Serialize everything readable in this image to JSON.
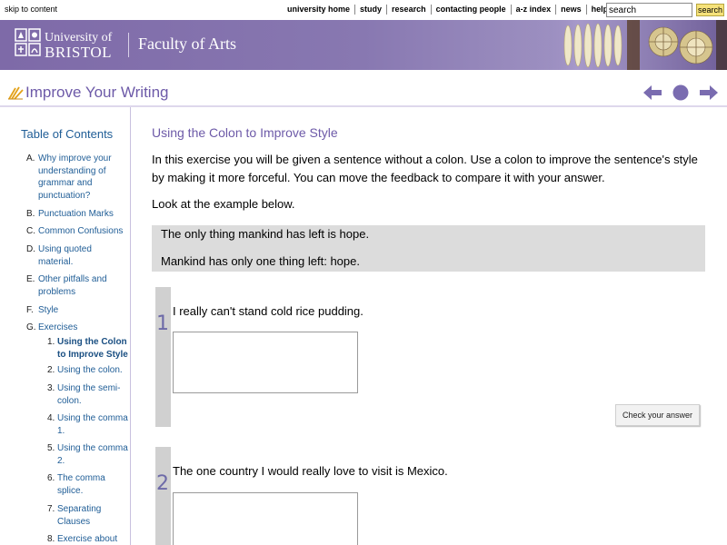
{
  "topbar": {
    "skip_link": "skip to content",
    "nav": [
      "university home",
      "study",
      "research",
      "contacting people",
      "a-z index",
      "news",
      "help"
    ],
    "search_value": "search",
    "search_button": "search"
  },
  "banner": {
    "university_line1": "University of",
    "university_line2": "BRISTOL",
    "faculty": "Faculty of Arts"
  },
  "page": {
    "title": "Improve Your Writing"
  },
  "sidebar": {
    "title": "Table of Contents",
    "items": [
      {
        "marker": "A.",
        "label": "Why improve your understanding of grammar and punctuation?"
      },
      {
        "marker": "B.",
        "label": "Punctuation Marks"
      },
      {
        "marker": "C.",
        "label": "Common Confusions"
      },
      {
        "marker": "D.",
        "label": "Using quoted material."
      },
      {
        "marker": "E.",
        "label": "Other pitfalls and problems"
      },
      {
        "marker": "F.",
        "label": "Style"
      },
      {
        "marker": "G.",
        "label": "Exercises"
      }
    ],
    "subitems": [
      {
        "marker": "1.",
        "label": "Using the Colon to Improve Style"
      },
      {
        "marker": "2.",
        "label": "Using the colon."
      },
      {
        "marker": "3.",
        "label": "Using the semi-colon."
      },
      {
        "marker": "4.",
        "label": "Using the comma 1."
      },
      {
        "marker": "5.",
        "label": "Using the comma 2."
      },
      {
        "marker": "6.",
        "label": "The comma splice."
      },
      {
        "marker": "7.",
        "label": "Separating Clauses"
      },
      {
        "marker": "8.",
        "label": "Exercise about"
      }
    ]
  },
  "main": {
    "heading": "Using the Colon to Improve Style",
    "intro": "In this exercise you will be given a sentence without a colon. Use a colon to improve the sentence's style by making it more forceful. You can move the feedback to compare it with your answer.",
    "look": "Look at the example below.",
    "example_before": "The only thing mankind has left is hope.",
    "example_after": "Mankind has only one thing left: hope.",
    "questions": [
      {
        "number": "1",
        "text": "I really can't stand cold rice pudding.",
        "answer": ""
      },
      {
        "number": "2",
        "text": "The one country I would really love to visit is Mexico.",
        "answer": ""
      }
    ],
    "check_button": "Check your answer"
  }
}
